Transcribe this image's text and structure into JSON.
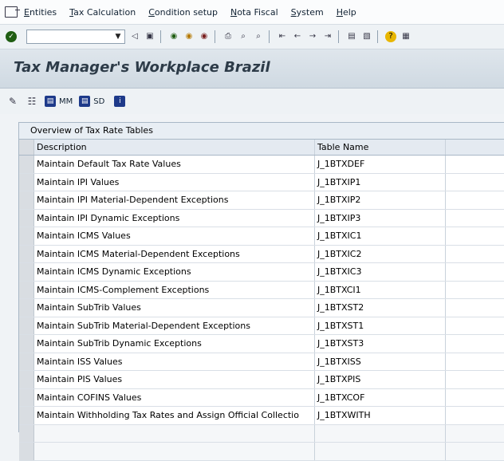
{
  "menu": [
    "Entities",
    "Tax Calculation",
    "Condition setup",
    "Nota Fiscal",
    "System",
    "Help"
  ],
  "toolbar": {
    "command_field_value": "",
    "icons": [
      "check-icon",
      "back-arrow-icon",
      "save-icon",
      "back-icon",
      "exit-icon",
      "cancel-icon",
      "print-icon",
      "find-icon",
      "find-next-icon",
      "first-page-icon",
      "prev-page-icon",
      "next-page-icon",
      "last-page-icon",
      "new-window-icon",
      "shortcut-icon",
      "help-icon",
      "settings-icon"
    ]
  },
  "title": "Tax Manager's Workplace Brazil",
  "app_toolbar": {
    "mm_label": "MM",
    "sd_label": "SD"
  },
  "panel": {
    "title": "Overview of Tax Rate Tables",
    "columns": [
      "Description",
      "Table Name"
    ],
    "rows": [
      {
        "description": "Maintain Default Tax Rate Values",
        "table": "J_1BTXDEF"
      },
      {
        "description": "Maintain IPI Values",
        "table": "J_1BTXIP1"
      },
      {
        "description": "Maintain IPI Material-Dependent Exceptions",
        "table": "J_1BTXIP2"
      },
      {
        "description": "Maintain IPI Dynamic Exceptions",
        "table": "J_1BTXIP3"
      },
      {
        "description": "Maintain ICMS Values",
        "table": "J_1BTXIC1"
      },
      {
        "description": "Maintain ICMS Material-Dependent Exceptions",
        "table": "J_1BTXIC2"
      },
      {
        "description": "Maintain ICMS Dynamic Exceptions",
        "table": "J_1BTXIC3"
      },
      {
        "description": "Maintain ICMS-Complement Exceptions",
        "table": "J_1BTXCI1"
      },
      {
        "description": "Maintain SubTrib Values",
        "table": "J_1BTXST2"
      },
      {
        "description": "Maintain SubTrib Material-Dependent Exceptions",
        "table": "J_1BTXST1"
      },
      {
        "description": "Maintain SubTrib Dynamic Exceptions",
        "table": "J_1BTXST3"
      },
      {
        "description": "Maintain ISS Values",
        "table": "J_1BTXISS"
      },
      {
        "description": "Maintain PIS Values",
        "table": "J_1BTXPIS"
      },
      {
        "description": "Maintain COFINS Values",
        "table": "J_1BTXCOF"
      },
      {
        "description": "Maintain Withholding Tax Rates and Assign Official Collectio",
        "table": "J_1BTXWITH"
      }
    ]
  }
}
